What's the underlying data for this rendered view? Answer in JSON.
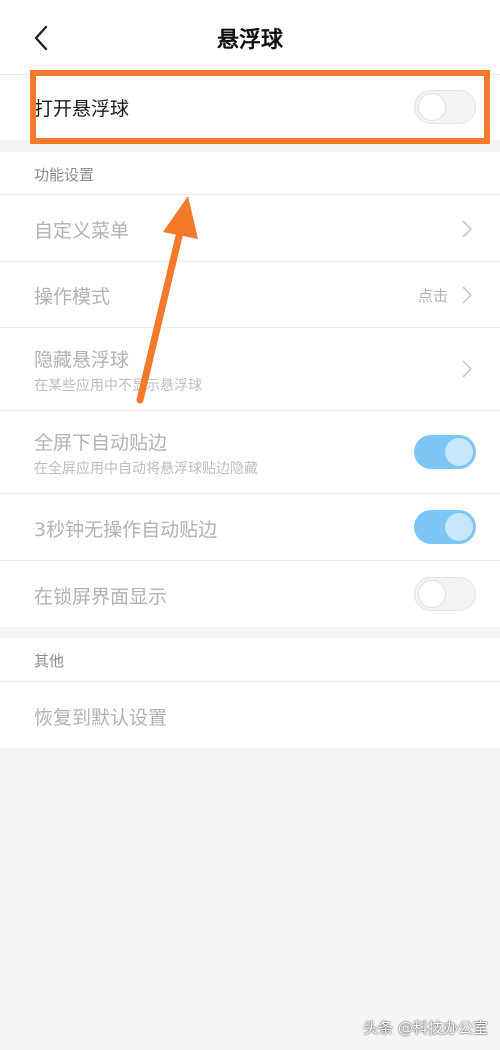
{
  "header": {
    "title": "悬浮球"
  },
  "main_toggle": {
    "label": "打开悬浮球",
    "state": "off"
  },
  "function_settings": {
    "title": "功能设置",
    "items": [
      {
        "label": "自定义菜单"
      },
      {
        "label": "操作模式",
        "value": "点击"
      },
      {
        "label": "隐藏悬浮球",
        "sublabel": "在某些应用中不显示悬浮球"
      },
      {
        "label": "全屏下自动贴边",
        "sublabel": "在全屏应用中自动将悬浮球贴边隐藏",
        "state": "on"
      },
      {
        "label": "3秒钟无操作自动贴边",
        "state": "on"
      },
      {
        "label": "在锁屏界面显示",
        "state": "off"
      }
    ]
  },
  "other": {
    "title": "其他",
    "items": [
      {
        "label": "恢复到默认设置"
      }
    ]
  },
  "watermark": "头条 @科技办公室",
  "colors": {
    "highlight": "#f4792b",
    "toggle_on": "#7cc7f5",
    "annotation_arrow": "#f4792b"
  }
}
